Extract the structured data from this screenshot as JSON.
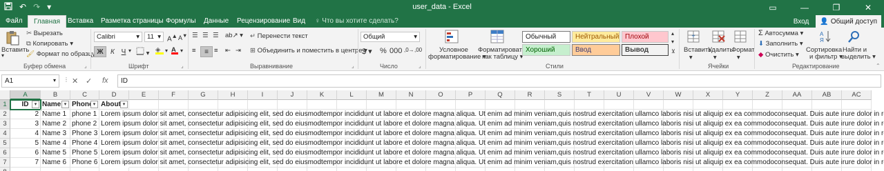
{
  "window": {
    "title": "user_data - Excel",
    "quick_access": [
      "save-icon",
      "undo-icon",
      "redo-icon",
      "customize-icon"
    ],
    "controls": [
      "minimize-icon",
      "restore-icon",
      "close-icon"
    ]
  },
  "tabs": {
    "items": [
      "Файл",
      "Главная",
      "Вставка",
      "Разметка страницы",
      "Формулы",
      "Данные",
      "Рецензирование",
      "Вид"
    ],
    "tell_me": "Что вы хотите сделать?",
    "signin": "Вход",
    "share": "Общий доступ"
  },
  "ribbon": {
    "clipboard": {
      "paste": "Вставить",
      "cut": "Вырезать",
      "copy": "Копировать",
      "format_painter": "Формат по образцу",
      "label": "Буфер обмена"
    },
    "font": {
      "name": "Calibri",
      "size": "11",
      "bold": "Ж",
      "italic": "К",
      "underline": "Ч",
      "label": "Шрифт"
    },
    "alignment": {
      "wrap": "Перенести текст",
      "merge": "Объединить и поместить в центре",
      "label": "Выравнивание"
    },
    "number": {
      "format": "Общий",
      "label": "Число"
    },
    "styles": {
      "conditional_1": "Условное",
      "conditional_2": "форматирование",
      "table_1": "Форматировать",
      "table_2": "как таблицу",
      "normal": "Обычный",
      "neutral": "Нейтральный",
      "bad": "Плохой",
      "good": "Хороший",
      "input": "Ввод",
      "output": "Вывод",
      "label": "Стили"
    },
    "cells": {
      "insert": "Вставить",
      "delete": "Удалить",
      "format": "Формат",
      "label": "Ячейки"
    },
    "editing": {
      "autosum": "Автосумма",
      "fill": "Заполнить",
      "clear": "Очистить",
      "sort_1": "Сортировка",
      "sort_2": "и фильтр",
      "find_1": "Найти и",
      "find_2": "выделить",
      "label": "Редактирование"
    }
  },
  "formula_bar": {
    "name_box": "A1",
    "cancel": "✕",
    "enter": "✓",
    "fx": "fx",
    "value": "ID"
  },
  "sheet": {
    "columns": [
      "A",
      "B",
      "C",
      "D",
      "E",
      "F",
      "G",
      "H",
      "I",
      "J",
      "K",
      "L",
      "M",
      "N",
      "O",
      "P",
      "Q",
      "R",
      "S",
      "T",
      "U",
      "V",
      "W",
      "X",
      "Y",
      "Z",
      "AA",
      "AB",
      "AC"
    ],
    "rows": [
      "1",
      "2",
      "3",
      "4",
      "5",
      "6",
      "7",
      "8"
    ],
    "header": {
      "id": "ID",
      "name": "Name",
      "phone": "Phone",
      "about": "About"
    },
    "data": [
      {
        "id": "2",
        "name": "Name 1",
        "phone": "phone 1"
      },
      {
        "id": "3",
        "name": "Name 2",
        "phone": "phone 2"
      },
      {
        "id": "4",
        "name": "Name 3",
        "phone": "Phone 3"
      },
      {
        "id": "5",
        "name": "Name 4",
        "phone": "Phone 4"
      },
      {
        "id": "6",
        "name": "Name 5",
        "phone": "Phone 5"
      },
      {
        "id": "7",
        "name": "Name 6",
        "phone": "Phone 6"
      }
    ],
    "about_text": "Lorem ipsum dolor sit amet, consectetur adipisicing elit, sed do eiusmodtempor incididunt ut labore et dolore magna aliqua. Ut enim ad minim veniam,quis nostrud exercitation ullamco laboris nisi ut aliquip ex ea commodoconsequat. Duis aute irure dolor in reprehenderit"
  }
}
